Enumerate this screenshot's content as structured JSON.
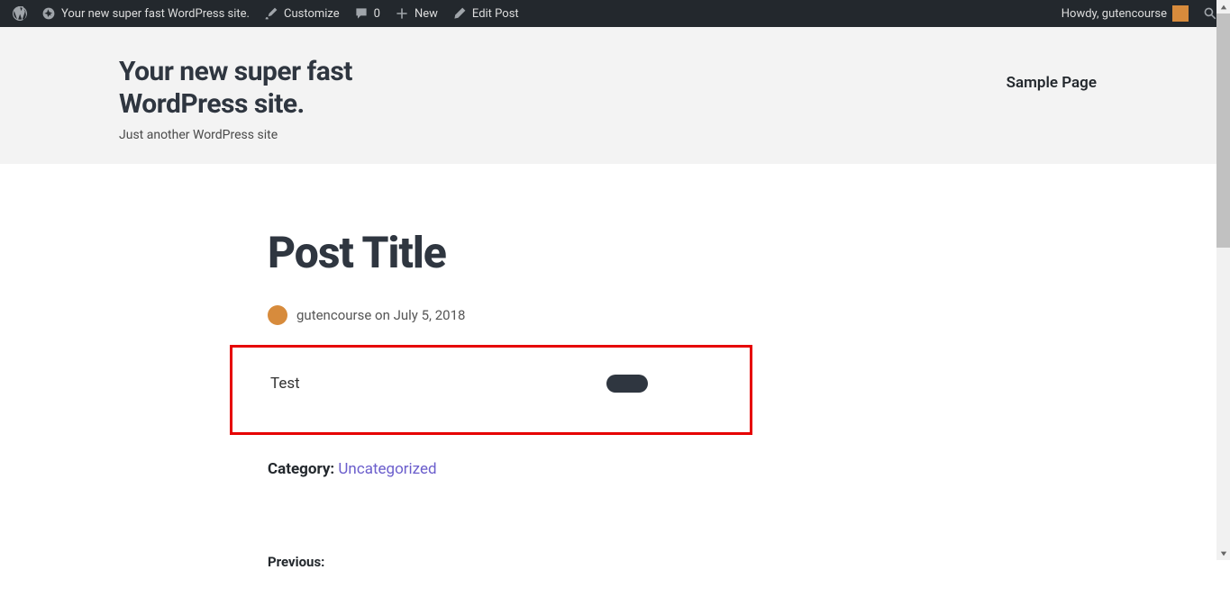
{
  "adminbar": {
    "site_name": "Your new super fast WordPress site.",
    "customize": "Customize",
    "comments_count": "0",
    "new": "New",
    "edit_post": "Edit Post",
    "howdy": "Howdy, gutencourse"
  },
  "header": {
    "title": "Your new super fast WordPress site.",
    "tagline": "Just another WordPress site",
    "nav_link": "Sample Page"
  },
  "post": {
    "title": "Post Title",
    "author": "gutencourse",
    "on": "on",
    "date": "July 5, 2018",
    "test_text": "Test",
    "category_label": "Category:",
    "category_link": "Uncategorized",
    "previous_label": "Previous:"
  }
}
